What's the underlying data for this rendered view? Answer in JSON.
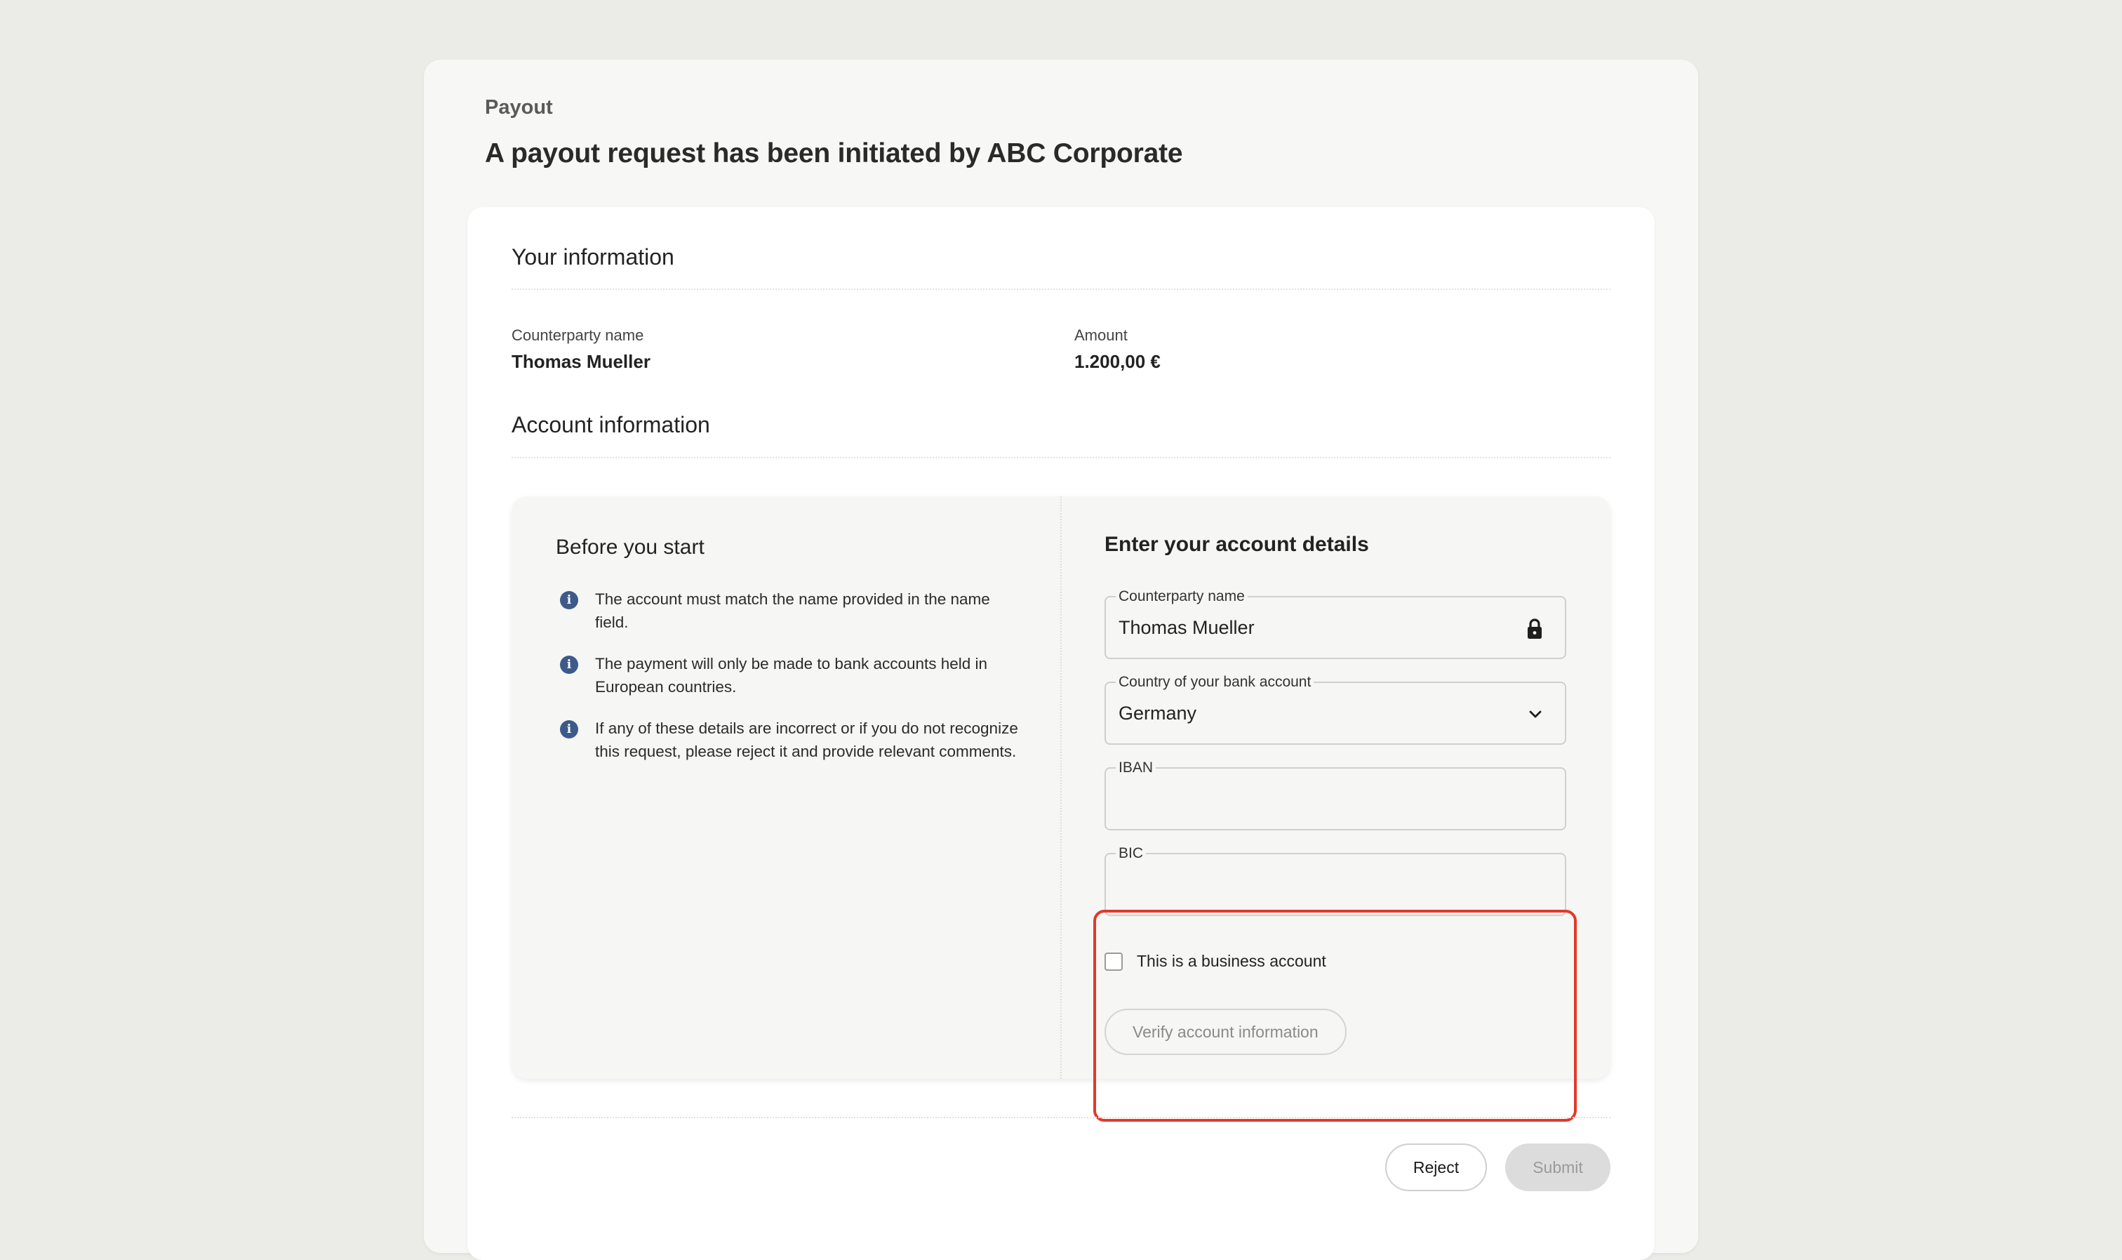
{
  "header": {
    "eyebrow": "Payout",
    "title": "A payout request has been initiated by ABC Corporate"
  },
  "your_information": {
    "heading": "Your information",
    "counterparty_label": "Counterparty name",
    "counterparty_value": "Thomas Mueller",
    "amount_label": "Amount",
    "amount_value": "1.200,00 €"
  },
  "account_information": {
    "heading": "Account information"
  },
  "before_you_start": {
    "title": "Before you start",
    "items": [
      {
        "icon": "info-icon",
        "text": "The account must match the name provided in the name field."
      },
      {
        "icon": "info-icon",
        "text": "The payment will only be made to bank accounts held in European countries."
      },
      {
        "icon": "info-icon",
        "text": "If any of these details are incorrect or if you do not recognize this request, please reject it and provide relevant comments."
      }
    ]
  },
  "account_form": {
    "title": "Enter your account details",
    "counterparty_label": "Counterparty name",
    "counterparty_value": "Thomas Mueller",
    "counterparty_icon": "lock-icon",
    "country_label": "Country of your bank account",
    "country_value": "Germany",
    "country_icon": "chevron-down-icon",
    "iban_label": "IBAN",
    "iban_value": "",
    "bic_label": "BIC",
    "bic_value": "",
    "business_checkbox_label": "This is a business account",
    "business_checked": false,
    "verify_label": "Verify account information",
    "highlight_color": "#e03a2a"
  },
  "actions": {
    "reject_label": "Reject",
    "submit_label": "Submit"
  }
}
